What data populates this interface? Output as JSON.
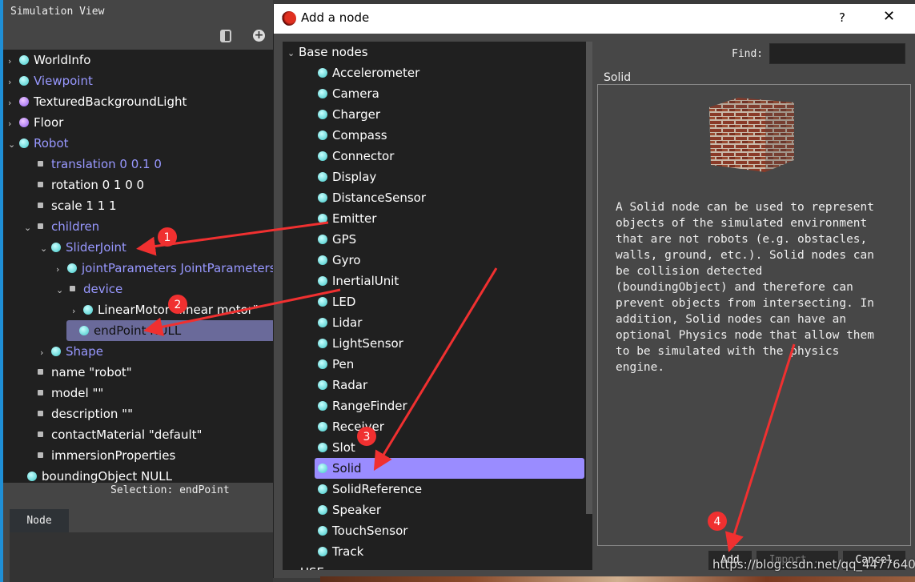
{
  "left": {
    "title": "Simulation View",
    "selection": "Selection: endPoint",
    "tab": "Node",
    "tree": [
      {
        "label": "WorldInfo",
        "chev": "›",
        "dot": "c",
        "lav": false,
        "lvl": 0
      },
      {
        "label": "Viewpoint",
        "chev": "›",
        "dot": "c",
        "lav": true,
        "lvl": 0
      },
      {
        "label": "TexturedBackgroundLight",
        "chev": "›",
        "dot": "p",
        "lav": false,
        "lvl": 0
      },
      {
        "label": "Floor",
        "chev": "›",
        "dot": "p",
        "lav": false,
        "lvl": 0
      },
      {
        "label": "Robot",
        "chev": "⌄",
        "dot": "c",
        "lav": true,
        "lvl": 0
      },
      {
        "label": "translation 0 0.1 0",
        "chev": "",
        "dot": "s",
        "lav": true,
        "lvl": 1
      },
      {
        "label": "rotation 0 1 0 0",
        "chev": "",
        "dot": "s",
        "lav": false,
        "lvl": 1
      },
      {
        "label": "scale 1 1 1",
        "chev": "",
        "dot": "s",
        "lav": false,
        "lvl": 1
      },
      {
        "label": "children",
        "chev": "⌄",
        "dot": "s",
        "lav": true,
        "lvl": 1
      },
      {
        "label": "SliderJoint",
        "chev": "⌄",
        "dot": "c",
        "lav": true,
        "lvl": 2
      },
      {
        "label": "jointParameters JointParameters",
        "chev": "›",
        "dot": "c",
        "lav": true,
        "lvl": 3
      },
      {
        "label": "device",
        "chev": "⌄",
        "dot": "s",
        "lav": true,
        "lvl": 3
      },
      {
        "label": "LinearMotor \"linear motor\"",
        "chev": "›",
        "dot": "c",
        "lav": false,
        "lvl": 4
      },
      {
        "label": "endPoint NULL",
        "chev": "",
        "dot": "c",
        "lav": false,
        "lvl": 4,
        "sel": true
      },
      {
        "label": "Shape",
        "chev": "›",
        "dot": "c",
        "lav": true,
        "lvl": 2
      },
      {
        "label": "name \"robot\"",
        "chev": "",
        "dot": "s",
        "lav": false,
        "lvl": 1
      },
      {
        "label": "model \"\"",
        "chev": "",
        "dot": "s",
        "lav": false,
        "lvl": 1
      },
      {
        "label": "description \"\"",
        "chev": "",
        "dot": "s",
        "lav": false,
        "lvl": 1
      },
      {
        "label": "contactMaterial \"default\"",
        "chev": "",
        "dot": "s",
        "lav": false,
        "lvl": 1
      },
      {
        "label": "immersionProperties",
        "chev": "",
        "dot": "s",
        "lav": false,
        "lvl": 1
      },
      {
        "label": "boundingObject NULL",
        "chev": "",
        "dot": "c",
        "lav": false,
        "lvl": 0.5
      }
    ]
  },
  "dialog": {
    "title": "Add a node",
    "help": "?",
    "close": "✕",
    "find_label": "Find:",
    "find_value": "",
    "group_title": "Solid",
    "root": "Base nodes",
    "use": "USE",
    "nodes": [
      "Accelerometer",
      "Camera",
      "Charger",
      "Compass",
      "Connector",
      "Display",
      "DistanceSensor",
      "Emitter",
      "GPS",
      "Gyro",
      "InertialUnit",
      "LED",
      "Lidar",
      "LightSensor",
      "Pen",
      "Radar",
      "RangeFinder",
      "Receiver",
      "Slot",
      "Solid",
      "SolidReference",
      "Speaker",
      "TouchSensor",
      "Track"
    ],
    "selected": "Solid",
    "description": "A Solid node can be used to represent\nobjects of the simulated environment\nthat are not robots (e.g. obstacles,\nwalls, ground, etc.). Solid nodes can\nbe collision detected\n(boundingObject) and therefore can\nprevent objects from intersecting. In\naddition, Solid nodes can have an\noptional Physics node that allow them\nto be simulated with the physics\nengine.",
    "buttons": {
      "add": "Add",
      "import": "Import...",
      "cancel": "Cancel"
    }
  },
  "annotations": [
    "1",
    "2",
    "3",
    "4"
  ],
  "watermark": "https://blog.csdn.net/qq_44776401",
  "colors": {
    "selection": "#9a8cff",
    "accent_arrow": "#f03030",
    "lavender_text": "#9898ff"
  }
}
